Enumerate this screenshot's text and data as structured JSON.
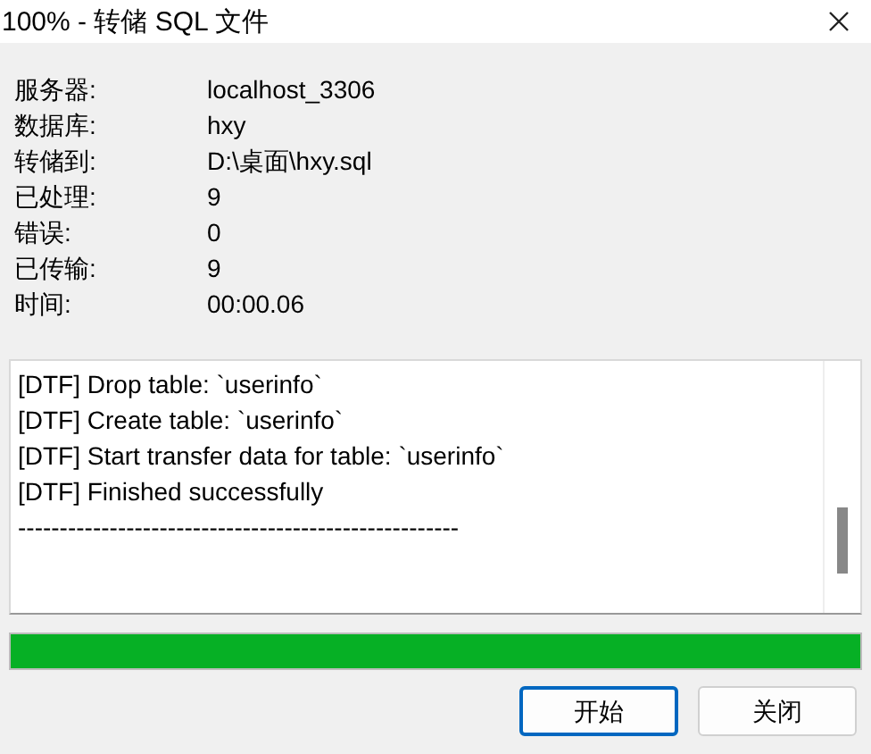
{
  "window": {
    "title": "100% - 转储 SQL 文件"
  },
  "info": [
    {
      "label": "服务器:",
      "value": "localhost_3306"
    },
    {
      "label": "数据库:",
      "value": "hxy"
    },
    {
      "label": "转储到:",
      "value": "D:\\桌面\\hxy.sql"
    },
    {
      "label": "已处理:",
      "value": "9"
    },
    {
      "label": "错误:",
      "value": "0"
    },
    {
      "label": "已传输:",
      "value": "9"
    },
    {
      "label": "时间:",
      "value": "00:00.06"
    }
  ],
  "log": [
    "[DTF] Drop table: `userinfo`",
    "[DTF] Create table: `userinfo`",
    "[DTF] Start transfer data for table: `userinfo`",
    "[DTF] Finished successfully",
    "-----------------------------------------------------"
  ],
  "progress": {
    "level": 1
  },
  "buttons": [
    {
      "label": "开始",
      "selected": true
    },
    {
      "label": "关闭",
      "selected": false
    }
  ]
}
